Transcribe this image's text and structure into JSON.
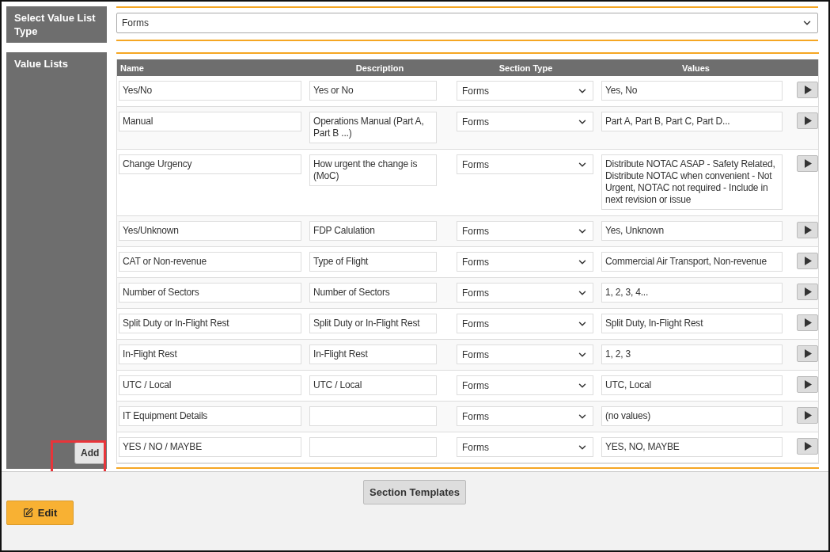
{
  "select_type": {
    "label": "Select Value List Type",
    "value": "Forms"
  },
  "value_lists": {
    "label": "Value Lists",
    "columns": [
      "Name",
      "Description",
      "Section Type",
      "Values"
    ],
    "rows": [
      {
        "name": "Yes/No",
        "description": "Yes or No",
        "section_type": "Forms",
        "values": "Yes, No"
      },
      {
        "name": "Manual",
        "description": "Operations Manual (Part A, Part B ...)",
        "section_type": "Forms",
        "values": "Part A, Part B, Part C, Part D..."
      },
      {
        "name": "Change Urgency",
        "description": "How urgent the change is (MoC)",
        "section_type": "Forms",
        "values": "Distribute NOTAC ASAP - Safety Related, Distribute NOTAC when convenient - Not Urgent, NOTAC not required - Include in next revision or issue"
      },
      {
        "name": "Yes/Unknown",
        "description": "FDP Calulation",
        "section_type": "Forms",
        "values": "Yes, Unknown"
      },
      {
        "name": "CAT or Non-revenue",
        "description": "Type of Flight",
        "section_type": "Forms",
        "values": "Commercial Air Transport, Non-revenue"
      },
      {
        "name": "Number of Sectors",
        "description": "Number of Sectors",
        "section_type": "Forms",
        "values": "1, 2, 3, 4..."
      },
      {
        "name": "Split Duty or In-Flight Rest",
        "description": "Split Duty or In-Flight Rest",
        "section_type": "Forms",
        "values": "Split Duty, In-Flight Rest"
      },
      {
        "name": "In-Flight Rest",
        "description": "In-Flight Rest",
        "section_type": "Forms",
        "values": "1, 2, 3"
      },
      {
        "name": "UTC / Local",
        "description": "UTC / Local",
        "section_type": "Forms",
        "values": "UTC, Local"
      },
      {
        "name": "IT Equipment Details",
        "section_type": "Forms",
        "values": "(no values)"
      },
      {
        "name": "YES / NO / MAYBE",
        "section_type": "Forms",
        "values": "YES, NO, MAYBE"
      }
    ],
    "add_button": "Add"
  },
  "footer": {
    "edit_button": "Edit",
    "templates_button": "Section Templates"
  }
}
